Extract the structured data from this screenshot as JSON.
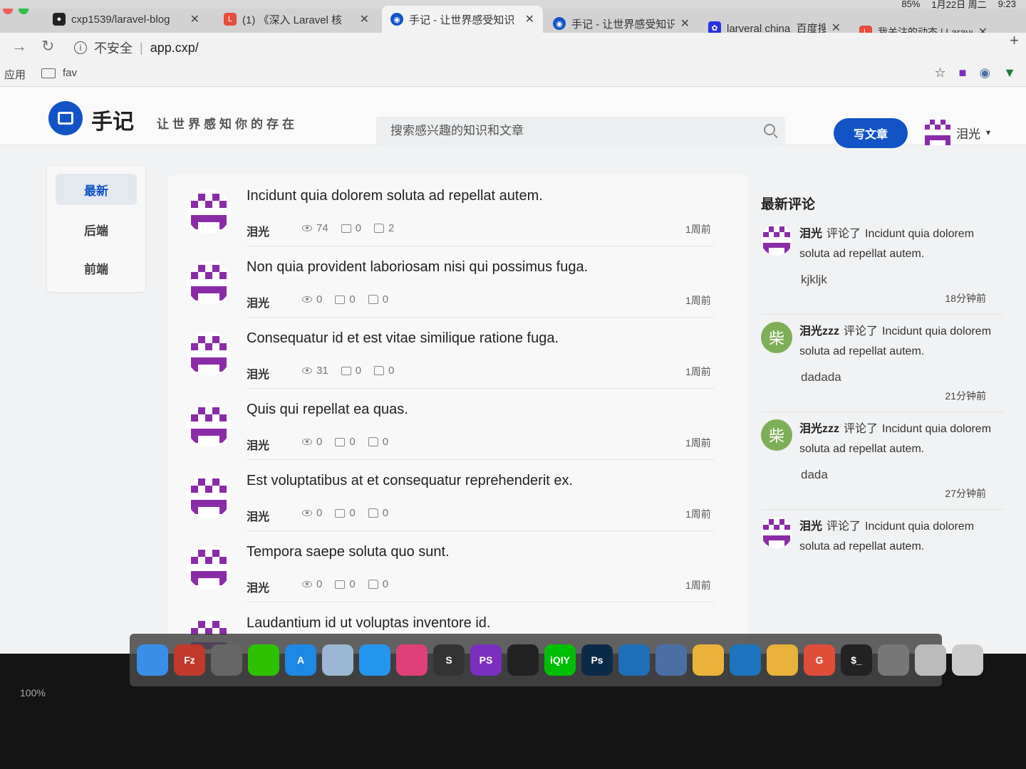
{
  "menubar": {
    "battery": "85%",
    "date": "1月22日 周二",
    "time": "9:23"
  },
  "tabs": [
    {
      "title": "cxp1539/laravel-blog",
      "favicon": "github-icon",
      "color": "#222"
    },
    {
      "title": "(1) 《深入 Laravel 核",
      "favicon": "laravel-icon",
      "color": "#e74c3c"
    },
    {
      "title": "手记 - 让世界感受知识",
      "favicon": "site-logo-icon",
      "color": "#1254c6"
    },
    {
      "title": "手记 - 让世界感受知识",
      "favicon": "site-logo-icon",
      "color": "#1254c6"
    },
    {
      "title": "larveral china_百度搜",
      "favicon": "baidu-icon",
      "color": "#2932e1"
    },
    {
      "title": "我关注的动态 | Larave",
      "favicon": "laravel-icon",
      "color": "#e74c3c"
    }
  ],
  "address": {
    "security": "不安全",
    "url": "app.cxp/"
  },
  "bookmarks": {
    "apps": "应用",
    "folder": "fav"
  },
  "site": {
    "logo_text": "手记",
    "slogan": "让世界感知你的存在",
    "search_placeholder": "搜索感兴趣的知识和文章",
    "write_button": "写文章",
    "user_name": "泪光",
    "user_caret": "▾"
  },
  "leftnav": {
    "items": [
      "最新",
      "后端",
      "前端"
    ],
    "active": 0
  },
  "articles": [
    {
      "title": "Incidunt quia dolorem soluta ad repellat autem.",
      "author": "泪光",
      "views": "74",
      "comments": "0",
      "likes": "2",
      "time": "1周前"
    },
    {
      "title": "Non quia provident laboriosam nisi qui possimus fuga.",
      "author": "泪光",
      "views": "0",
      "comments": "0",
      "likes": "0",
      "time": "1周前"
    },
    {
      "title": "Consequatur id et est vitae similique ratione fuga.",
      "author": "泪光",
      "views": "31",
      "comments": "0",
      "likes": "0",
      "time": "1周前"
    },
    {
      "title": "Quis qui repellat ea quas.",
      "author": "泪光",
      "views": "0",
      "comments": "0",
      "likes": "0",
      "time": "1周前"
    },
    {
      "title": "Est voluptatibus at et consequatur reprehenderit ex.",
      "author": "泪光",
      "views": "0",
      "comments": "0",
      "likes": "0",
      "time": "1周前"
    },
    {
      "title": "Tempora saepe soluta quo sunt.",
      "author": "泪光",
      "views": "0",
      "comments": "0",
      "likes": "0",
      "time": "1周前"
    },
    {
      "title": "Laudantium id ut voluptas inventore id.",
      "author": "",
      "views": "",
      "comments": "",
      "likes": "",
      "time": ""
    }
  ],
  "sidebar": {
    "heading": "最新评论",
    "comments": [
      {
        "user": "泪光",
        "action": "评论了",
        "target": "Incidunt quia dolorem soluta ad repellat autem.",
        "body": "kjkljk",
        "time": "18分钟前",
        "avatar": "identicon"
      },
      {
        "user": "泪光zzz",
        "action": "评论了",
        "target": "Incidunt quia dolorem soluta ad repellat autem.",
        "body": "dadada",
        "time": "21分钟前",
        "avatar": "柴"
      },
      {
        "user": "泪光zzz",
        "action": "评论了",
        "target": "Incidunt quia dolorem soluta ad repellat autem.",
        "body": "dada",
        "time": "27分钟前",
        "avatar": "柴"
      },
      {
        "user": "泪光",
        "action": "评论了",
        "target": "Incidunt quia dolorem soluta ad repellat autem.",
        "body": "",
        "time": "",
        "avatar": "identicon"
      }
    ]
  },
  "dock": {
    "apps": [
      {
        "name": "finder-icon",
        "label": "",
        "color": "#3a8ee6"
      },
      {
        "name": "filezilla-icon",
        "label": "Fz",
        "color": "#c0392b"
      },
      {
        "name": "launchpad-icon",
        "label": "",
        "color": "#666"
      },
      {
        "name": "wechat-icon",
        "label": "",
        "color": "#2dc100"
      },
      {
        "name": "appstore-icon",
        "label": "A",
        "color": "#1e88e5"
      },
      {
        "name": "preview-icon",
        "label": "",
        "color": "#9bb7d4"
      },
      {
        "name": "docker-icon",
        "label": "",
        "color": "#2496ed"
      },
      {
        "name": "record-icon",
        "label": "",
        "color": "#e0407a"
      },
      {
        "name": "sublime-icon",
        "label": "S",
        "color": "#333"
      },
      {
        "name": "phpstorm-icon",
        "label": "PS",
        "color": "#7b2fbf"
      },
      {
        "name": "qq-icon",
        "label": "",
        "color": "#222"
      },
      {
        "name": "iqiyi-icon",
        "label": "iQIY",
        "color": "#00be06"
      },
      {
        "name": "photoshop-icon",
        "label": "Ps",
        "color": "#0b2a4a"
      },
      {
        "name": "shark-icon",
        "label": "",
        "color": "#1e6fb8"
      },
      {
        "name": "virtualbox-icon",
        "label": "",
        "color": "#4a6fa5"
      },
      {
        "name": "chrome-icon",
        "label": "",
        "color": "#e9b33b"
      },
      {
        "name": "vscode-icon",
        "label": "",
        "color": "#1e73be"
      },
      {
        "name": "duck-icon",
        "label": "",
        "color": "#e8b13a"
      },
      {
        "name": "git-icon",
        "label": "G",
        "color": "#e04e39"
      },
      {
        "name": "terminal-icon",
        "label": "$_",
        "color": "#222"
      },
      {
        "name": "settings-icon",
        "label": "",
        "color": "#777"
      },
      {
        "name": "sequel-icon",
        "label": "",
        "color": "#bbb"
      },
      {
        "name": "trash-icon",
        "label": "",
        "color": "#ccc"
      }
    ],
    "zoom": "100%"
  }
}
